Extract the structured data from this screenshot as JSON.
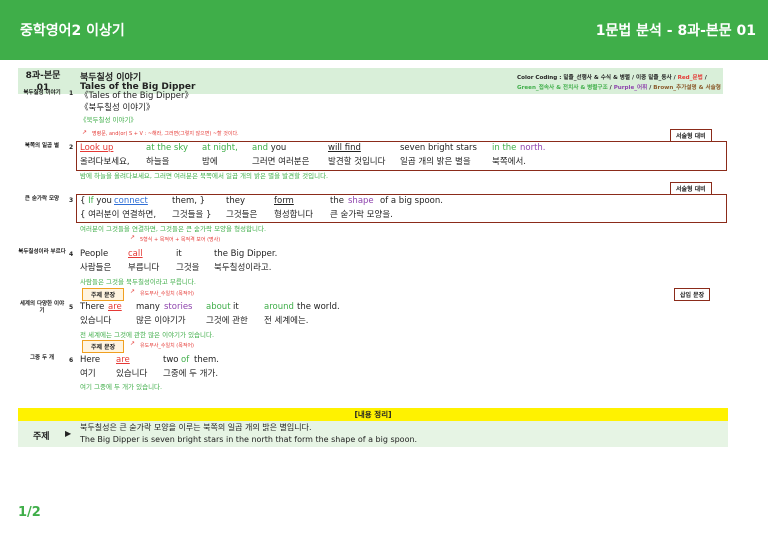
{
  "header": {
    "left_title": "중학영어2 이상기",
    "right_title": "1문법 분석 - 8과-본문 01"
  },
  "lesson": {
    "label_line1": "8과-본문",
    "label_line2": "01",
    "title_ko": "북두칠성 이야기",
    "title_en": "Tales of the Big Dipper"
  },
  "color_coding": {
    "line1": "Color Coding : 밑줄_선행사 & 수식 & 병렬 / 이중 밑줄_동사 / ",
    "red": "Red_문법",
    "slash1": " /",
    "green": "Green_접속사 & 전치사 & 병렬구조",
    "slash2": " / ",
    "purple": "Purple_어휘",
    "slash3": " / ",
    "brown": "Brown_추가설명 & 서술형"
  },
  "rows": [
    {
      "side": "북두칠성 이야기",
      "num": "1",
      "en": "《Tales of the Big Dipper》",
      "ko": "《북두칠성 이야기》",
      "trans": "《북두칠성 이야기》"
    },
    {
      "side": "북쪽의 일곱 별",
      "num": "2",
      "note": "명령문, and(or)  S + V : ~해라, 그러면(그렇지 않으면) ~할 것이다.",
      "tag": "서술형 대비",
      "en": [
        "Look up",
        "at the sky",
        "at night,",
        "and you",
        "will find",
        "seven bright stars",
        "in the",
        "north."
      ],
      "ko": [
        "올려다보세요,",
        "하늘을",
        "밤에",
        "그러면 여러분은",
        "발견할 것입니다",
        "일곱 개의 밝은 별을",
        "북쪽에서."
      ],
      "trans": "밤에 하늘을 올려다보세요, 그러면 여러분은 북쪽에서 일곱 개의 밝은 별을 발견할 것입니다."
    },
    {
      "side": "큰 숟가락 모양",
      "num": "3",
      "tag": "서술형 대비",
      "en": [
        "{ If you",
        "connect",
        "them, }",
        "they",
        "form",
        "the",
        "shape",
        "of a big spoon."
      ],
      "ko": [
        "{ 여러분이 연결하면,",
        "그것들을 }",
        "그것들은",
        "형성합니다",
        "큰 숟가락 모양을."
      ],
      "trans": "여러분이 그것들을 연결하면, 그것들은 큰 숟가락 모양을 형성합니다."
    },
    {
      "side": "북두칠성이라 부르다",
      "num": "4",
      "note": "5형식 + 목적어 + 목적격 보어 (명사)",
      "en": [
        "People",
        "call",
        "it",
        "the Big Dipper."
      ],
      "ko": [
        "사람들은",
        "부릅니다",
        "그것을",
        "북두칠성이라고."
      ],
      "trans": "사람들은 그것을 북두칠성이라고 부릅니다."
    },
    {
      "side": "세계의 다양한 이야기",
      "num": "5",
      "topic": "주제 문장",
      "note": "유도부사_수일치 (목적어)",
      "tag": "삽입 문장",
      "en": [
        "There",
        "are",
        "many",
        "stories",
        "about",
        "it",
        "around",
        "the world."
      ],
      "ko": [
        "있습니다",
        "많은 이야기가",
        "그것에 관한",
        "전 세계에는."
      ],
      "trans": "전 세계에는 그것에 관한 많은 이야기가 있습니다."
    },
    {
      "side": "그중 두 개",
      "num": "6",
      "topic": "주제 문장",
      "note": "유도부사_수일치 (목적어)",
      "en": [
        "Here",
        "are",
        "two",
        "of",
        "them."
      ],
      "ko": [
        "여기",
        "있습니다",
        "그중에 두 개가."
      ],
      "trans": "여기 그중에 두 개가 있습니다."
    }
  ],
  "summary": {
    "heading": "[내용 정리]",
    "label": "주제",
    "arrow": "▶",
    "ko": "북두칠성은 큰 숟가락 모양을 이루는 북쪽의 일곱 개의 밝은 별입니다.",
    "en": "The Big Dipper is seven bright stars in the north that form the shape of a big spoon."
  },
  "page": "1/2"
}
